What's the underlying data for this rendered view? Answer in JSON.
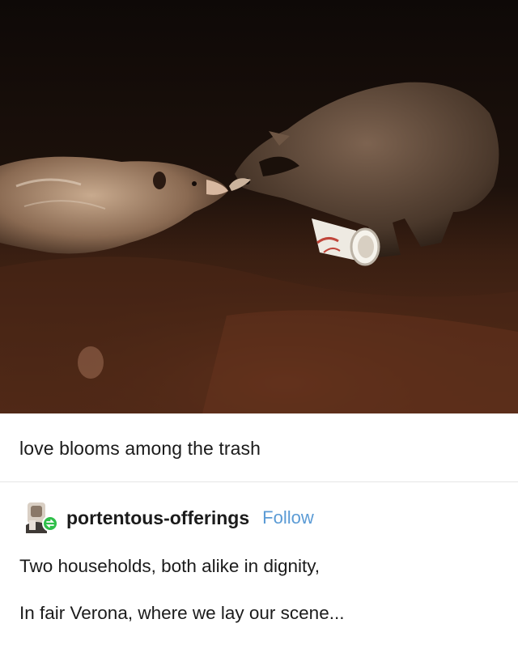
{
  "post": {
    "photo": {
      "description_icon": "raccoon-opossum-photo",
      "colors": {
        "night": "#120b08",
        "ground": "#5a2e1a",
        "cup": "#f0eee8"
      }
    },
    "caption": "love blooms among the trash",
    "reblog": {
      "username": "portentous-offerings",
      "follow_label": "Follow",
      "lines": [
        "Two households, both alike in dignity,",
        "In fair Verona, where we lay our scene..."
      ]
    },
    "accent": "#5b9bd5",
    "avatar_badge_color": "#2fbf4a"
  }
}
